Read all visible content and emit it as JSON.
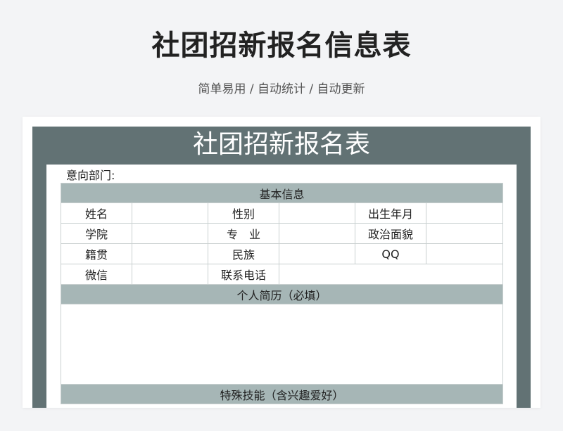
{
  "header": {
    "title": "社团招新报名信息表",
    "subtitle": "简单易用 / 自动统计 / 自动更新"
  },
  "sheet": {
    "title": "社团招新报名表",
    "department_label": "意向部门:",
    "sections": {
      "basic_info": "基本信息",
      "resume": "个人简历（必填）",
      "skills": "特殊技能（含兴趣爱好）"
    },
    "fields": {
      "name": "姓名",
      "gender": "性别",
      "birth_year_month": "出生年月",
      "college": "学院",
      "major": "专　业",
      "political_status": "政治面貌",
      "hometown": "籍贯",
      "ethnicity": "民族",
      "qq": "QQ",
      "wechat": "微信",
      "phone": "联系电话"
    }
  },
  "colors": {
    "background": "#f3f4f6",
    "sheet_frame": "#627274",
    "section_header": "#a6b6b6",
    "grid_line": "#c9d0d0"
  }
}
